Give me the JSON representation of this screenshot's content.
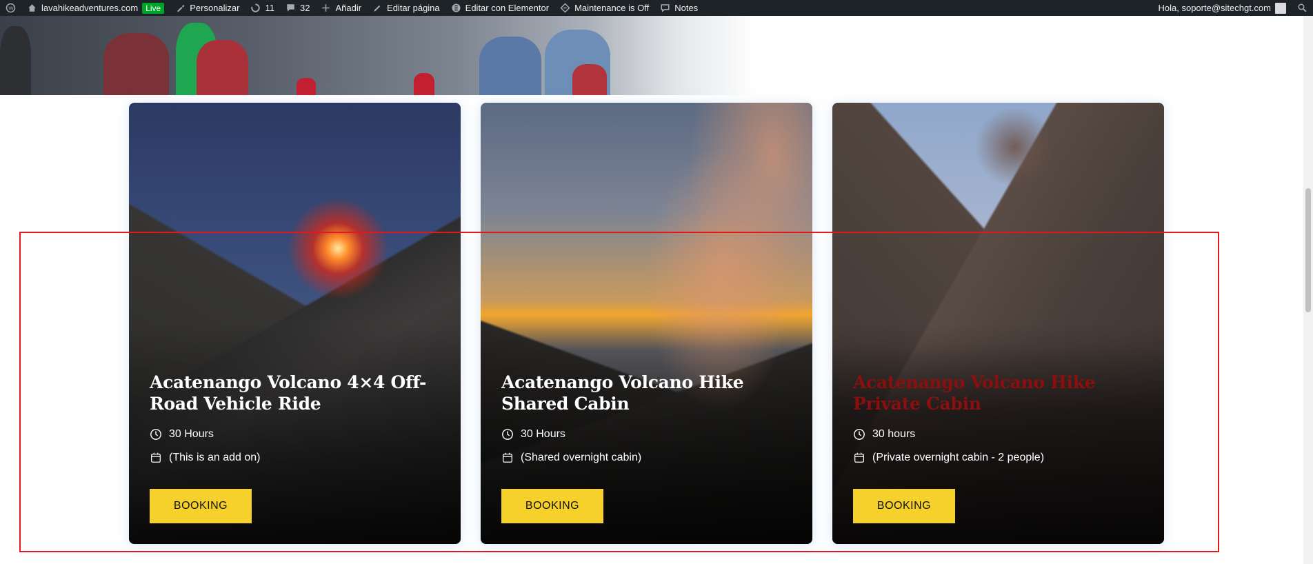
{
  "adminbar": {
    "site": "lavahikeadventures.com",
    "live": "Live",
    "customize": "Personalizar",
    "updates": "11",
    "comments": "32",
    "add_new": "Añadir",
    "edit_page": "Editar página",
    "edit_elementor": "Editar con Elementor",
    "maintenance": "Maintenance is Off",
    "notes": "Notes",
    "greeting": "Hola, soporte@sitechgt.com"
  },
  "cards": [
    {
      "title": "Acatenango Volcano 4×4 Off-Road Vehicle Ride",
      "duration": "30 Hours",
      "note": "(This is an add on)",
      "button": "BOOKING"
    },
    {
      "title": "Acatenango Volcano Hike Shared Cabin",
      "duration": "30 Hours",
      "note": "(Shared overnight cabin)",
      "button": "BOOKING"
    },
    {
      "title": "Acatenango Volcano Hike Private Cabin",
      "duration": "30 hours",
      "note": "(Private overnight cabin - 2 people)",
      "button": "BOOKING"
    }
  ],
  "colors": {
    "adminbar_bg": "#1d2327",
    "live_badge": "#00a32a",
    "button_bg": "#f6d12c",
    "hover_title": "#8b0f0f",
    "annotation_frame": "#e0191f"
  }
}
